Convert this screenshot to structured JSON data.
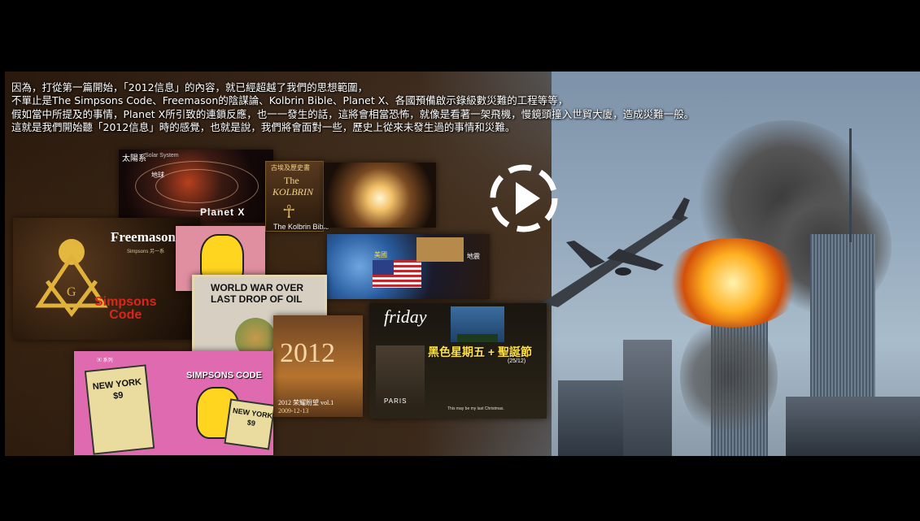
{
  "caption": {
    "lines": [
      "因為，打從第一篇開始，「2012信息」的內容，就已經超越了我們的思想範圍，",
      "不單止是The Simpsons Code、Freemason的陰謀論、Kolbrin Bible、Planet X、各國預備啟示錄級數災難的工程等等，",
      "假如當中所提及的事情，Planet X所引致的連鎖反應，也一一發生的話，這將會相當恐怖，就像是看著一架飛機，慢鏡頭撞入世貿大廈，造成災難一般。",
      "這就是我們開始聽「2012信息」時的感覺，也就是說，我們將會面對一些，歷史上從來未發生過的事情和災難。"
    ]
  },
  "collage": {
    "solar_title": "太陽系",
    "solar_subtitle": "Solar System",
    "solar_earth": "地球",
    "planet_x": "Planet X",
    "kolbrin_top": "古埃及歷史書",
    "kolbrin_the": "The",
    "kolbrin_name": "KOLBRIN",
    "kolbrin_caption": "The Kolbrin Bible",
    "freemason": "Freemason",
    "freemason_sub": "Simpsons  另一系",
    "simpsons_code": "Simpsons\nCode",
    "usa": "美國",
    "disaster": "地震",
    "newspaper_headline1": "WORLD WAR OVER",
    "newspaper_headline2": "LAST DROP OF OIL",
    "book_year": "2012",
    "book_title": "2012 荣耀盼望 vol.1",
    "book_date": "2009-12-13",
    "friday": "friday",
    "black_friday": "黑色星期五 + 聖誕節",
    "black_friday_date": "(25/12)",
    "paris": "PARIS",
    "last_christmas": "This may be my last Christmas.",
    "simpsons_code_banner": "SIMPSONS CODE",
    "ny_sign_left": "NEW YORK\n$9",
    "ny_sign_right": "NEW YORK\n$9",
    "small_tag": "▣ 系列"
  },
  "player": {
    "play_icon": "play-icon"
  }
}
